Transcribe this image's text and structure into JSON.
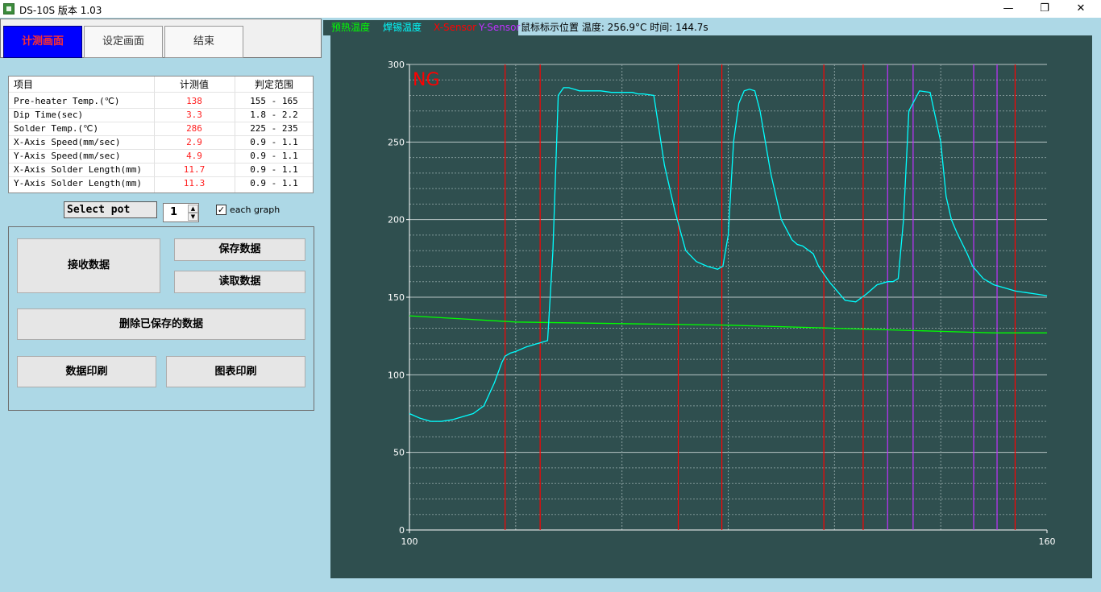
{
  "window": {
    "title": "DS-10S 版本 1.03",
    "controls": [
      "—",
      "❐",
      "✕"
    ]
  },
  "tabs": [
    {
      "label": "计测画面",
      "active": true
    },
    {
      "label": "设定画面",
      "active": false
    },
    {
      "label": "结束",
      "active": false
    }
  ],
  "table": {
    "headers": [
      "项目",
      "计测值",
      "判定范围"
    ],
    "rows": [
      {
        "item": "Pre-heater Temp.(℃)",
        "value": "138",
        "range": "155 - 165"
      },
      {
        "item": "Dip Time(sec)",
        "value": "3.3",
        "range": "1.8 - 2.2"
      },
      {
        "item": "Solder Temp.(℃)",
        "value": "286",
        "range": "225 - 235"
      },
      {
        "item": "X-Axis Speed(mm/sec)",
        "value": "2.9",
        "range": "0.9 - 1.1"
      },
      {
        "item": "Y-Axis Speed(mm/sec)",
        "value": "4.9",
        "range": "0.9 - 1.1"
      },
      {
        "item": "X-Axis Solder Length(mm)",
        "value": "11.7",
        "range": "0.9 - 1.1"
      },
      {
        "item": "Y-Axis Solder Length(mm)",
        "value": "11.3",
        "range": "0.9 - 1.1"
      }
    ]
  },
  "controls": {
    "select_pot_label": "Select pot",
    "pot_value": "1",
    "each_graph_label": "each graph",
    "each_graph_checked": "✓"
  },
  "buttons": {
    "receive": "接收数据",
    "save": "保存数据",
    "read": "读取数据",
    "delete": "删除已保存的数据",
    "print_data": "数据印刷",
    "print_chart": "图表印刷"
  },
  "legend": {
    "preheat": "预热温度",
    "solder": "焊锡温度",
    "x_sensor": "X-Sensor",
    "y_sensor": "Y-Sensor",
    "mouse_info": "鼠标标示位置 温度: 256.9°C 时间: 144.7s"
  },
  "colors": {
    "panel": "#2f4f4f",
    "preheat": "#00ff00",
    "solder": "#00ffff",
    "x_sensor": "#ff0000",
    "y_sensor": "#c030ff",
    "active_tab": "#0000ff",
    "ng": "#ff0000"
  },
  "chart_data": {
    "type": "line",
    "status_label": "NG",
    "xlim": [
      100,
      160
    ],
    "ylim": [
      0,
      300
    ],
    "x_tick_labels": [
      "100",
      "160"
    ],
    "y_ticks": [
      0,
      50,
      100,
      150,
      200,
      250,
      300
    ],
    "grid": true,
    "series": [
      {
        "name": "预热温度",
        "color": "#00ff00",
        "x": [
          100,
          110,
          120,
          130,
          140,
          150,
          155,
          160
        ],
        "y": [
          138,
          134,
          133,
          132,
          130,
          128,
          127,
          127
        ]
      },
      {
        "name": "焊锡温度",
        "color": "#00ffff",
        "x": [
          100,
          101,
          102,
          103,
          104,
          105,
          106,
          107,
          108,
          108.7,
          109,
          109.5,
          110,
          111,
          112,
          113,
          113.5,
          114,
          114.5,
          115,
          115.5,
          116,
          117,
          118,
          119,
          120,
          121,
          121.5,
          122,
          123,
          124,
          125,
          126,
          127,
          128,
          129,
          129.5,
          130,
          130.5,
          131,
          131.5,
          132,
          132.5,
          133,
          134,
          135,
          136,
          136.5,
          137,
          138,
          138.5,
          139,
          139.5,
          140,
          141,
          142,
          143,
          144,
          145,
          145.5,
          146,
          146.5,
          147,
          148,
          149,
          150,
          150.5,
          151,
          151.5,
          152,
          152.5,
          153,
          154,
          155,
          156,
          157,
          158,
          159,
          160
        ],
        "y": [
          75,
          72,
          70,
          70,
          71,
          73,
          75,
          80,
          95,
          108,
          112,
          114,
          115,
          118,
          120,
          122,
          180,
          280,
          285,
          285,
          284,
          283,
          283,
          283,
          282,
          282,
          282,
          281,
          281,
          280,
          235,
          205,
          180,
          173,
          170,
          168,
          170,
          190,
          250,
          275,
          283,
          284,
          283,
          270,
          230,
          200,
          187,
          184,
          183,
          178,
          170,
          165,
          160,
          156,
          148,
          147,
          152,
          158,
          160,
          160,
          162,
          200,
          270,
          283,
          282,
          250,
          215,
          200,
          192,
          185,
          178,
          170,
          162,
          158,
          156,
          154,
          153,
          152,
          151
        ]
      }
    ],
    "x_sensor_lines": [
      109,
      112.3,
      125.3,
      129.4,
      139,
      142.7
    ],
    "y_sensor_lines": [
      145,
      147.4,
      153.1,
      155.3
    ],
    "red_extra_lines": [
      157
    ]
  }
}
